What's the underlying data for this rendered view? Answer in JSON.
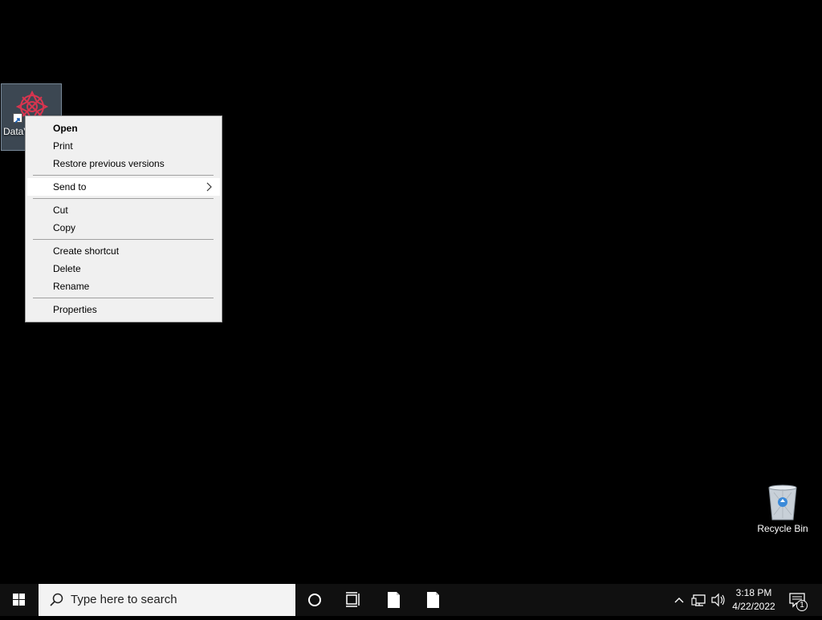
{
  "desktop": {
    "icons": [
      {
        "label": "DataV",
        "icon": "datavision-app-icon",
        "selected": true
      },
      {
        "label": "Recycle Bin",
        "icon": "recycle-bin-icon"
      }
    ]
  },
  "context_menu": {
    "items": [
      {
        "label": "Open",
        "bold": true
      },
      {
        "label": "Print"
      },
      {
        "label": "Restore previous versions"
      },
      {
        "label": "Send to",
        "submenu": true,
        "highlighted": true
      },
      {
        "label": "Cut"
      },
      {
        "label": "Copy"
      },
      {
        "label": "Create shortcut"
      },
      {
        "label": "Delete"
      },
      {
        "label": "Rename"
      },
      {
        "label": "Properties"
      }
    ]
  },
  "taskbar": {
    "search_placeholder": "Type here to search",
    "clock": {
      "time": "3:18 PM",
      "date": "4/22/2022"
    },
    "notification_count": "1",
    "icons": [
      "windows-start-icon",
      "search-icon",
      "cortana-icon",
      "task-view-icon",
      "document-icon",
      "document-icon",
      "chevron-up-icon",
      "network-icon",
      "volume-icon",
      "action-center-icon"
    ]
  },
  "colors": {
    "desktop_bg": "#000000",
    "taskbar_bg": "#101010",
    "menu_bg": "#f0f0f0",
    "menu_highlight": "#ffffff",
    "icon_selection": "#6e8296"
  }
}
